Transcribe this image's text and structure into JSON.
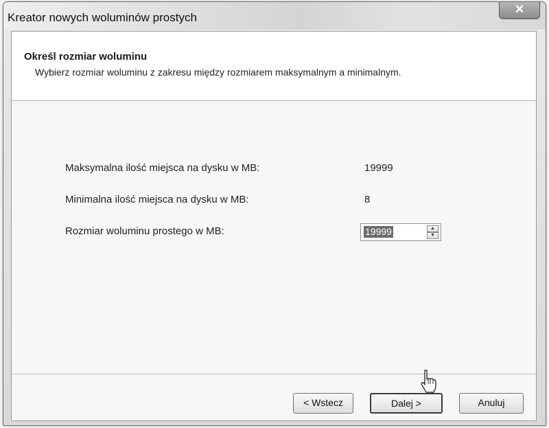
{
  "window": {
    "title": "Kreator nowych woluminów prostych",
    "close_icon": "close-icon"
  },
  "header": {
    "title": "Określ rozmiar woluminu",
    "description": "Wybierz rozmiar woluminu z zakresu między rozmiarem maksymalnym a minimalnym."
  },
  "fields": {
    "max_label": "Maksymalna ilość miejsca na dysku w MB:",
    "max_value": "19999",
    "min_label": "Minimalna ilość miejsca na dysku w MB:",
    "min_value": "8",
    "size_label": "Rozmiar woluminu prostego w MB:",
    "size_value": "19999"
  },
  "buttons": {
    "back": "< Wstecz",
    "next": "Dalej >",
    "cancel": "Anuluj"
  }
}
